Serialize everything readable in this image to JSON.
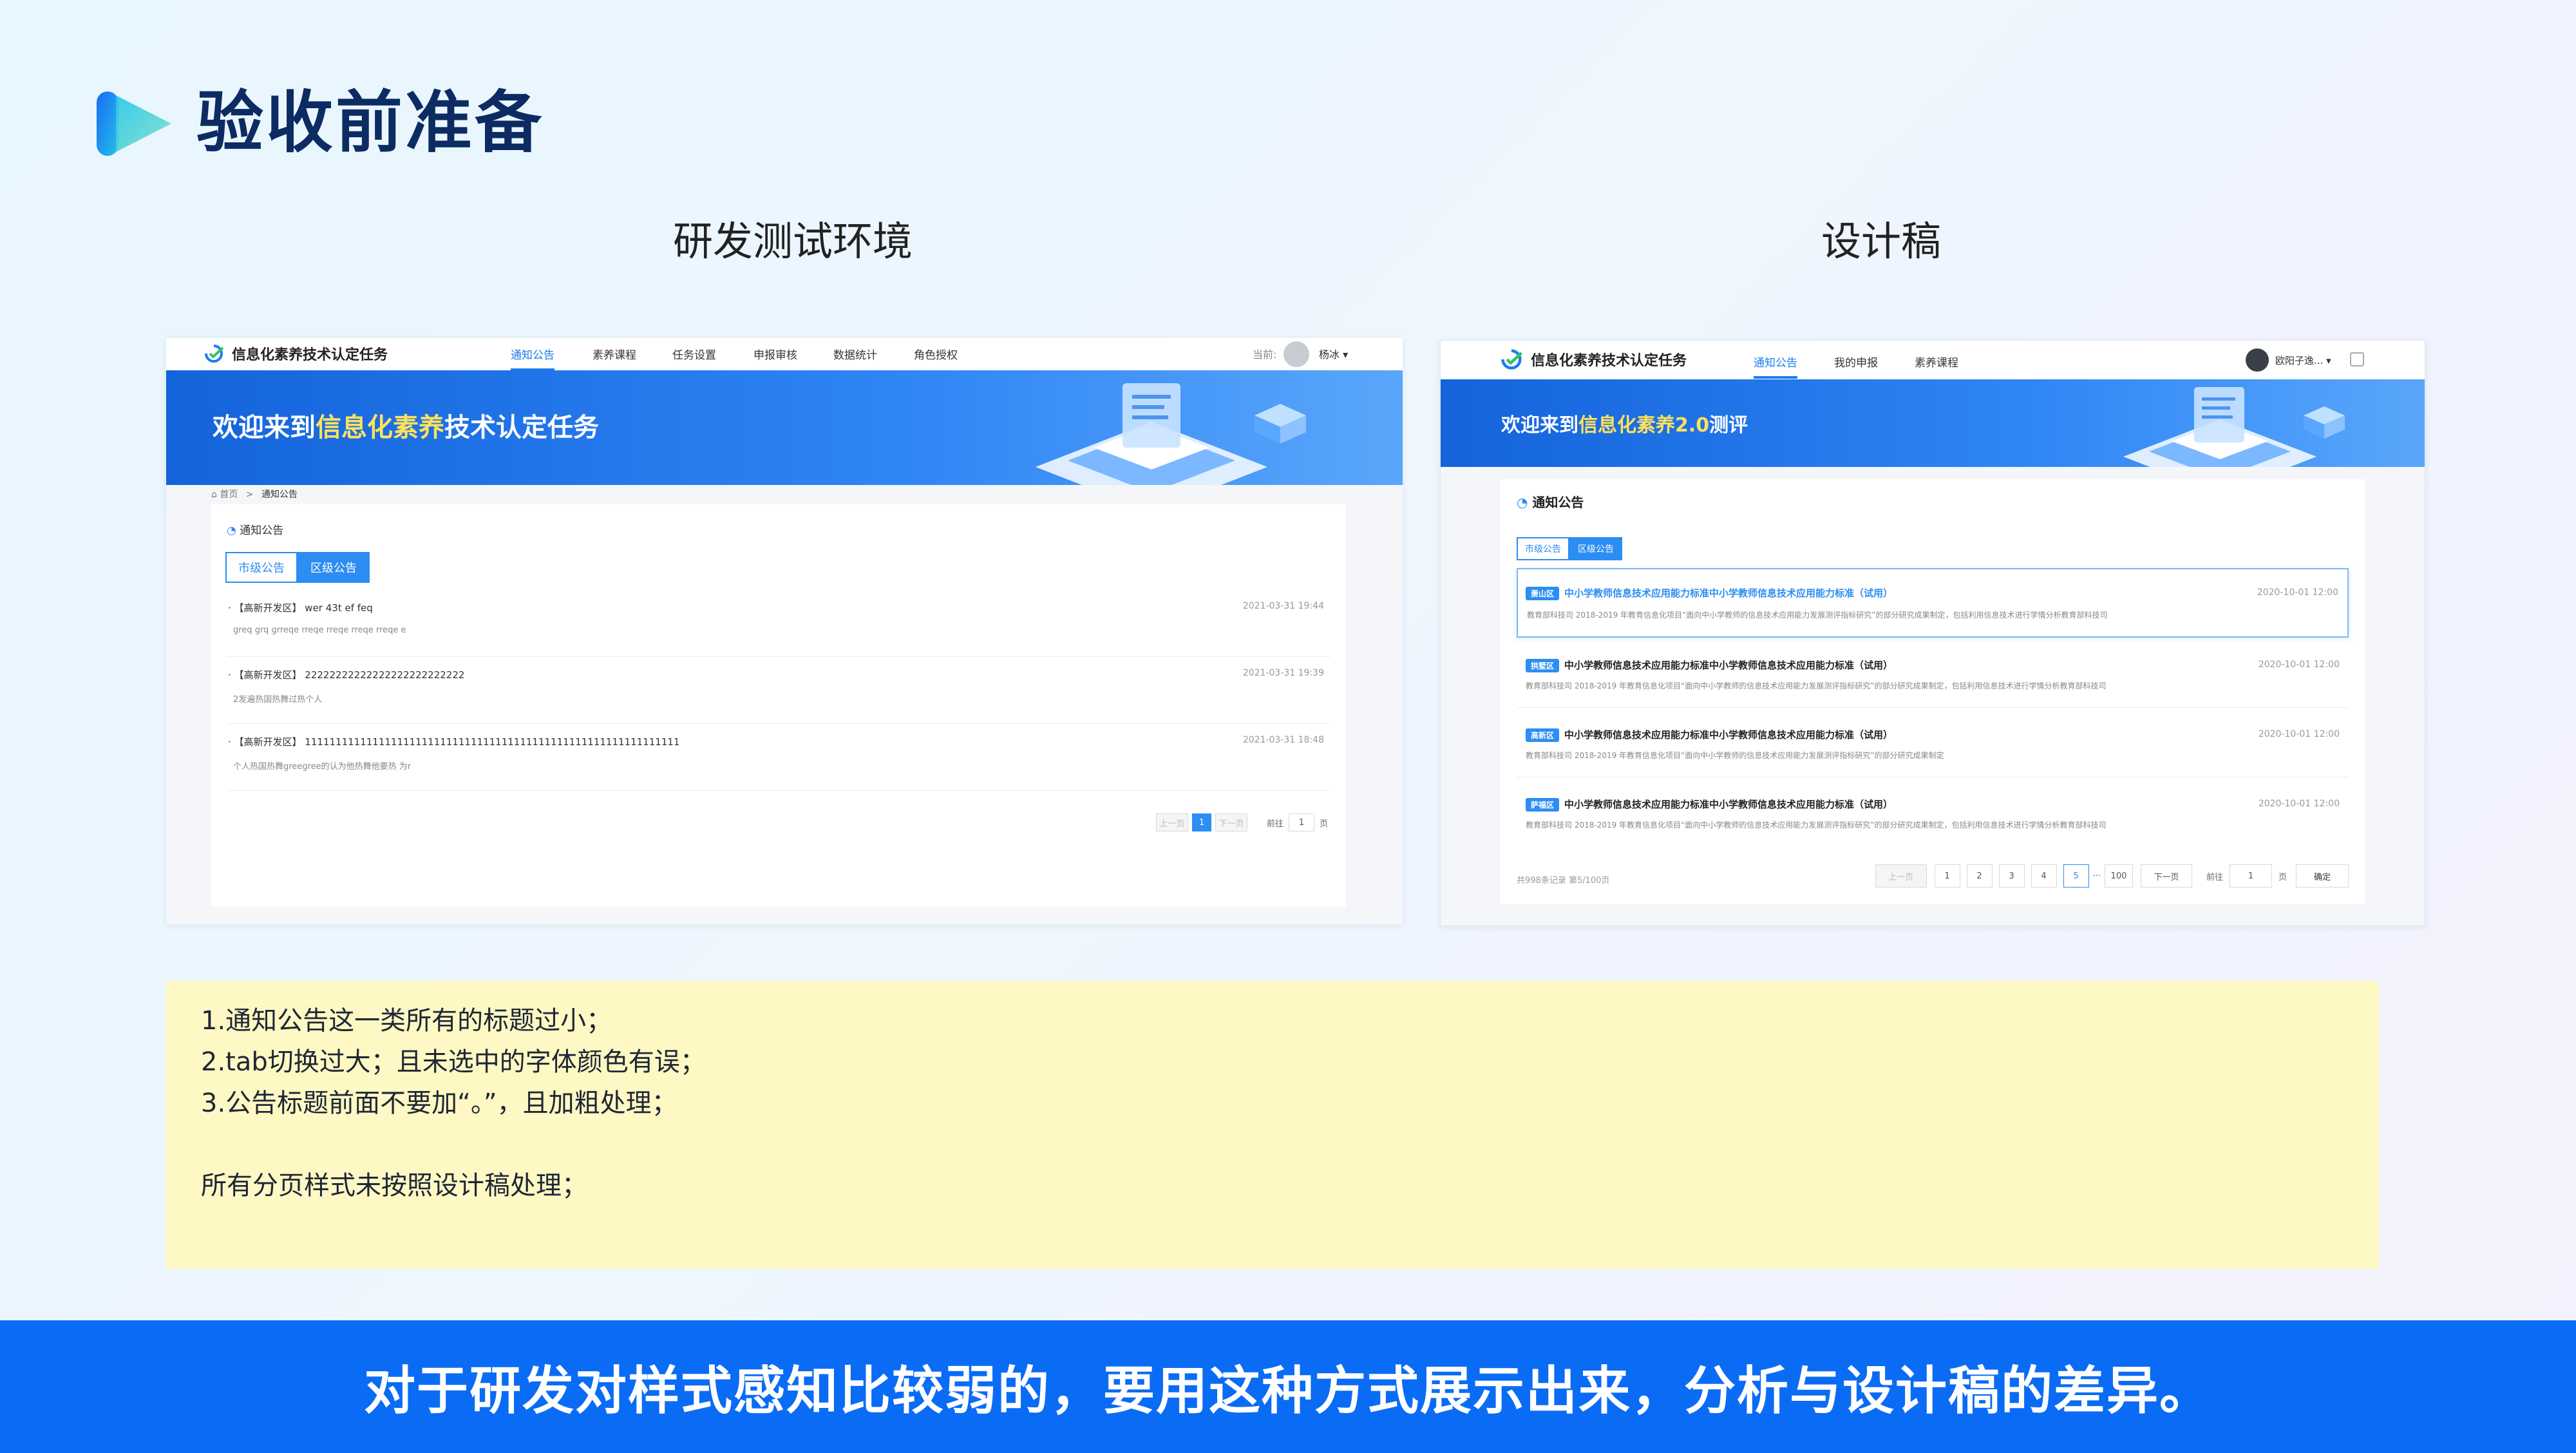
{
  "header": {
    "title": "验收前准备"
  },
  "columns": {
    "left_title": "研发测试环境",
    "right_title": "设计稿"
  },
  "dev_screen": {
    "brand": "信息化素养技术认定任务",
    "nav": [
      "通知公告",
      "素养课程",
      "任务设置",
      "申报审核",
      "数据统计",
      "角色授权"
    ],
    "active_nav_index": 0,
    "current_label": "当前:",
    "user_name": "杨冰 ▾",
    "banner_prefix": "欢迎来到",
    "banner_highlight": "信息化素养",
    "banner_suffix": "技术认定任务",
    "breadcrumb_home": "首页",
    "breadcrumb_sep": ">",
    "breadcrumb_current": "通知公告",
    "section_title": "通知公告",
    "tabs": [
      "市级公告",
      "区级公告"
    ],
    "selected_tab_index": 1,
    "items": [
      {
        "title": "·  【高新开发区】 wer 43t ef feq",
        "date": "2021-03-31 19:44",
        "desc": "greq grq grreqe rreqe rreqe rreqe rreqe e"
      },
      {
        "title": "·  【高新开发区】 22222222222222222222222222",
        "date": "2021-03-31 19:39",
        "desc": "2发遍热国热舞过热个人"
      },
      {
        "title": "·  【高新开发区】 1111111111111111111111111111111111111111111111111111111111111",
        "date": "2021-03-31 18:48",
        "desc": "个人热国热舞greegree的认为他热舞他要热 为r"
      }
    ],
    "pager": {
      "prev": "上一页",
      "page": "1",
      "next": "下一页",
      "goto": "前往",
      "page_input": "1",
      "page_suffix": "页"
    }
  },
  "design_screen": {
    "brand": "信息化素养技术认定任务",
    "nav": [
      "通知公告",
      "我的申报",
      "素养课程"
    ],
    "active_nav_index": 0,
    "user_name": "欧阳子逸... ▾",
    "banner_prefix": "欢迎来到",
    "banner_highlight": "信息化素养2.0",
    "banner_suffix": "测评",
    "section_title": "通知公告",
    "tabs": [
      "市级公告",
      "区级公告"
    ],
    "selected_tab_index": 1,
    "items": [
      {
        "badge": "萧山区",
        "title": "中小学教师信息技术应用能力标准中小学教师信息技术应用能力标准（试用）",
        "date": "2020-10-01 12:00",
        "desc": "教育部科技司 2018-2019 年教育信息化项目“面向中小学教师的信息技术应用能力发展测评指标研究”的部分研究成果制定，包括利用信息技术进行学情分析教育部科技司",
        "highlighted": true
      },
      {
        "badge": "拱墅区",
        "title": "中小学教师信息技术应用能力标准中小学教师信息技术应用能力标准（试用）",
        "date": "2020-10-01 12:00",
        "desc": "教育部科技司 2018-2019 年教育信息化项目“面向中小学教师的信息技术应用能力发展测评指标研究”的部分研究成果制定，包括利用信息技术进行学情分析教育部科技司",
        "highlighted": false
      },
      {
        "badge": "高新区",
        "title": "中小学教师信息技术应用能力标准中小学教师信息技术应用能力标准（试用）",
        "date": "2020-10-01 12:00",
        "desc": "教育部科技司 2018-2019 年教育信息化项目“面向中小学教师的信息技术应用能力发展测评指标研究”的部分研究成果制定",
        "highlighted": false
      },
      {
        "badge": "萨福区",
        "title": "中小学教师信息技术应用能力标准中小学教师信息技术应用能力标准（试用）",
        "date": "2020-10-01 12:00",
        "desc": "教育部科技司 2018-2019 年教育信息化项目“面向中小学教师的信息技术应用能力发展测评指标研究”的部分研究成果制定，包括利用信息技术进行学情分析教育部科技司",
        "highlighted": false
      }
    ],
    "pager": {
      "summary": "共998条记录  第5/100页",
      "prev": "上一页",
      "pages": [
        "1",
        "2",
        "3",
        "4",
        "5"
      ],
      "current_page": "5",
      "ellipsis": "···",
      "last": "100",
      "next": "下一页",
      "goto": "前往",
      "page_input": "1",
      "page_suffix": "页",
      "confirm": "确定"
    }
  },
  "notes": {
    "lines": [
      "1.通知公告这一类所有的标题过小；",
      "2.tab切换过大；且未选中的字体颜色有误；",
      "3.公告标题前面不要加“。”，且加粗处理；",
      "所有分页样式未按照设计稿处理；"
    ]
  },
  "footer": {
    "text": "对于研发对样式感知比较弱的，要用这种方式展示出来，分析与设计稿的差异。"
  },
  "colors": {
    "brand_blue": "#0a6cf5",
    "title_navy": "#0d2b63",
    "note_bg": "#fdf8c4",
    "link_blue": "#2c8df2",
    "banner_highlight": "#ffe25c"
  }
}
